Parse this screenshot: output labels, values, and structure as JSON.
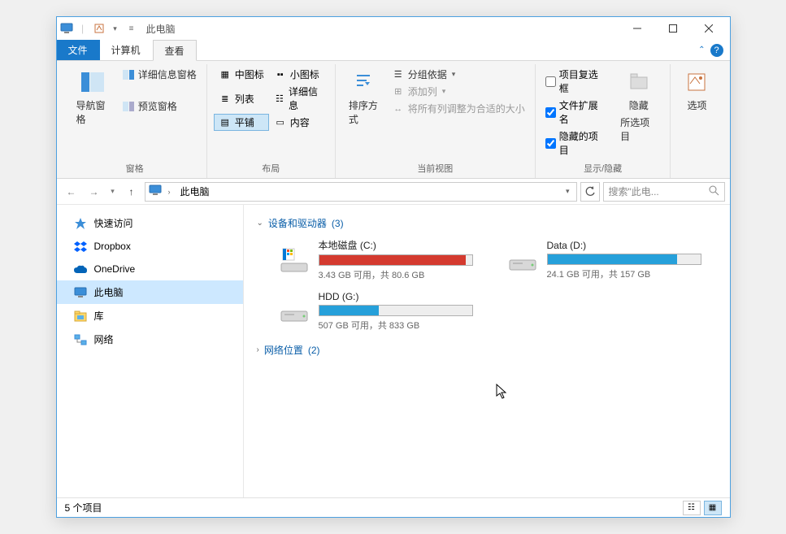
{
  "title": "此电脑",
  "tabs": {
    "file": "文件",
    "computer": "计算机",
    "view": "查看"
  },
  "ribbon": {
    "panes": {
      "nav_pane": "导航窗格",
      "preview_pane": "预览窗格",
      "details_pane": "详细信息窗格",
      "label": "窗格"
    },
    "layout": {
      "medium_icons": "中图标",
      "small_icons": "小图标",
      "list": "列表",
      "details": "详细信息",
      "tiles": "平铺",
      "content": "内容",
      "label": "布局"
    },
    "current_view": {
      "sort_by": "排序方式",
      "group_by": "分组依据",
      "add_columns": "添加列",
      "autosize": "将所有列调整为合适的大小",
      "label": "当前视图"
    },
    "show_hide": {
      "item_checkboxes": "项目复选框",
      "file_ext": "文件扩展名",
      "hidden_items": "隐藏的项目",
      "hide": "隐藏",
      "hide_sub": "所选项目",
      "label": "显示/隐藏"
    },
    "options": "选项"
  },
  "address": {
    "location": "此电脑"
  },
  "search": {
    "placeholder": "搜索\"此电..."
  },
  "sidebar": {
    "items": [
      {
        "label": "快速访问"
      },
      {
        "label": "Dropbox"
      },
      {
        "label": "OneDrive"
      },
      {
        "label": "此电脑"
      },
      {
        "label": "库"
      },
      {
        "label": "网络"
      }
    ]
  },
  "groups": {
    "devices": {
      "label": "设备和驱动器",
      "count": "(3)"
    },
    "network": {
      "label": "网络位置",
      "count": "(2)"
    }
  },
  "drives": [
    {
      "name": "本地磁盘 (C:)",
      "status": "3.43 GB 可用，共 80.6 GB",
      "fill_pct": 96,
      "color": "red",
      "type": "system"
    },
    {
      "name": "Data (D:)",
      "status": "24.1 GB 可用，共 157 GB",
      "fill_pct": 85,
      "color": "blue",
      "type": "hdd"
    },
    {
      "name": "HDD (G:)",
      "status": "507 GB 可用，共 833 GB",
      "fill_pct": 39,
      "color": "blue",
      "type": "hdd"
    }
  ],
  "statusbar": {
    "count": "5 个项目"
  }
}
